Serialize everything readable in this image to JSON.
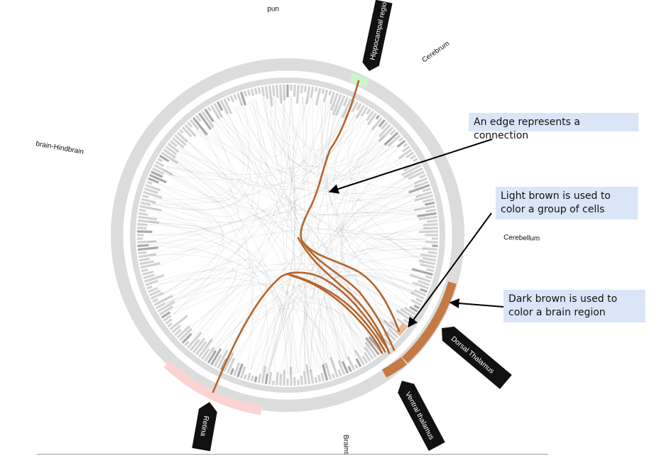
{
  "region_labels": {
    "top_cut": "und",
    "cerebrum": "Cerebrum",
    "midbrain_hindbrain": "brain-Hindbrain",
    "cerebellum": "Cerebellum",
    "brainstem_cut": "Brains"
  },
  "tags": {
    "hippocampal": "Hippocampal regio",
    "dorsal_thalamus": "Dorsal Thalamus",
    "ventral_thalamus": "Ventral thalamus",
    "retina": "Retina"
  },
  "callouts": {
    "edge": "An edge represents a connection",
    "light_brown": "Light brown is used to color a group of cells",
    "dark_brown": "Dark brown is used to color a brain region"
  },
  "colors": {
    "ring": "#dcdcdc",
    "highlight_edge": "#b5652b",
    "dark_brown": "#c57a45",
    "light_brown": "#e9b893",
    "retina_pink": "#fbd3d3",
    "hippocampal_green": "#cdf5cd",
    "callout_bg": "#dbe5f8",
    "tag_bg": "#111111"
  }
}
